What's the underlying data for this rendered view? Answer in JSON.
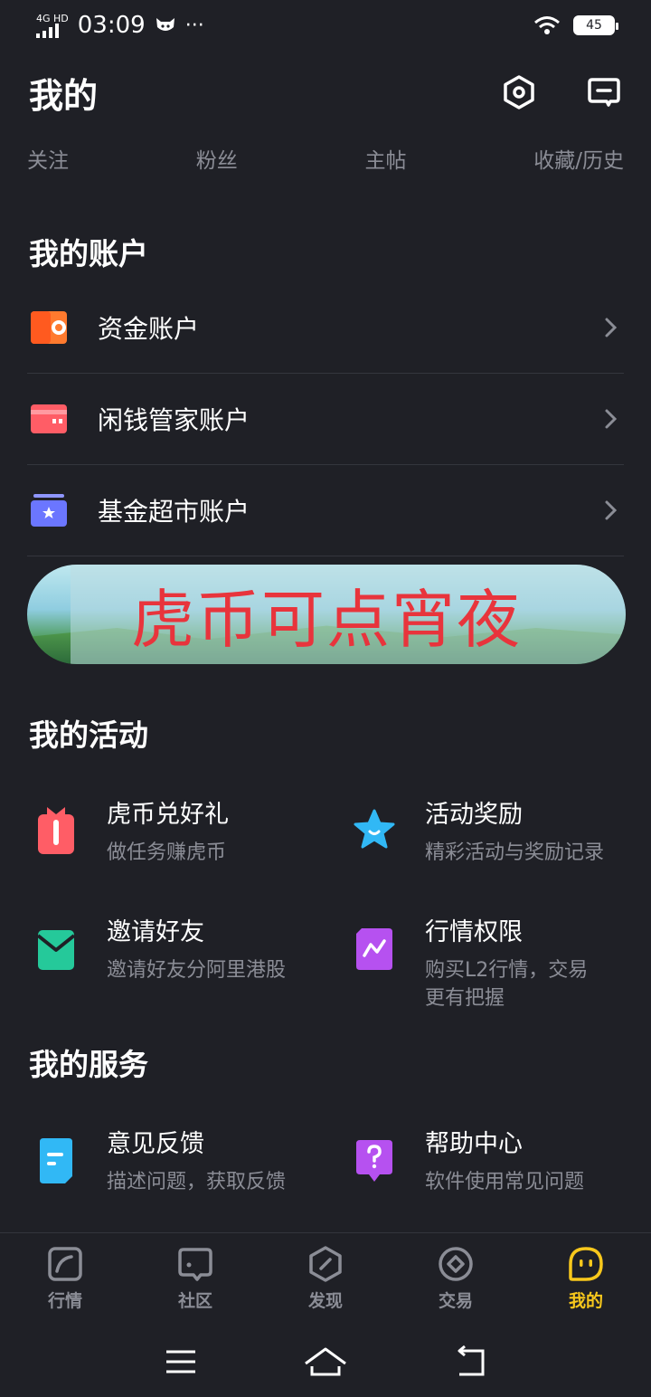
{
  "status": {
    "network": "4G HD",
    "time": "03:09",
    "more": "···",
    "battery": "45"
  },
  "header": {
    "title": "我的",
    "settings_icon": "settings-hex-icon",
    "message_icon": "message-icon"
  },
  "stats": [
    {
      "label": "关注"
    },
    {
      "label": "粉丝"
    },
    {
      "label": "主帖"
    },
    {
      "label": "收藏/历史"
    }
  ],
  "accounts": {
    "title": "我的账户",
    "items": [
      {
        "label": "资金账户",
        "icon": "wallet-icon",
        "color": "#ff7a2e"
      },
      {
        "label": "闲钱管家账户",
        "icon": "card-icon",
        "color": "#ff5d66"
      },
      {
        "label": "基金超市账户",
        "icon": "fund-icon",
        "color": "#6b76ff"
      }
    ]
  },
  "banner": {
    "text": "虎币可点宵夜"
  },
  "activities": {
    "title": "我的活动",
    "items": [
      {
        "title": "虎币兑好礼",
        "sub": "做任务赚虎币",
        "icon": "gift-icon",
        "color": "#ff5d66"
      },
      {
        "title": "活动奖励",
        "sub": "精彩活动与奖励记录",
        "icon": "star-icon",
        "color": "#31b8f5"
      },
      {
        "title": "邀请好友",
        "sub": "邀请好友分阿里港股",
        "icon": "invite-envelope-icon",
        "color": "#25c99a"
      },
      {
        "title": "行情权限",
        "sub": "购买L2行情，交易更有把握",
        "icon": "chart-permission-icon",
        "color": "#b651f0"
      }
    ]
  },
  "services": {
    "title": "我的服务",
    "items": [
      {
        "title": "意见反馈",
        "sub": "描述问题，获取反馈",
        "icon": "feedback-icon",
        "color": "#31b8f5"
      },
      {
        "title": "帮助中心",
        "sub": "软件使用常见问题",
        "icon": "help-icon",
        "color": "#b651f0"
      }
    ]
  },
  "nav": [
    {
      "label": "行情",
      "icon": "market-icon",
      "active": false
    },
    {
      "label": "社区",
      "icon": "community-icon",
      "active": false
    },
    {
      "label": "发现",
      "icon": "discover-icon",
      "active": false
    },
    {
      "label": "交易",
      "icon": "trade-icon",
      "active": false
    },
    {
      "label": "我的",
      "icon": "me-icon",
      "active": true
    }
  ],
  "colors": {
    "background": "#1f2026",
    "accent": "#f8c81c",
    "muted_text": "#8b8d96"
  }
}
